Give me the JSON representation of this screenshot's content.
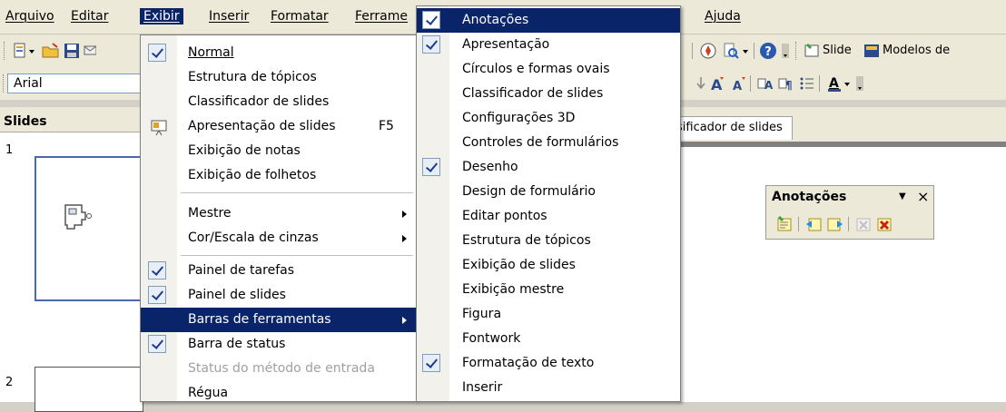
{
  "menubar": {
    "items": [
      {
        "label": "Arquivo",
        "active": false
      },
      {
        "label": "Editar",
        "active": false
      },
      {
        "label": "Exibir",
        "active": true
      },
      {
        "label": "Inserir",
        "active": false
      },
      {
        "label": "Formatar",
        "active": false
      },
      {
        "label": "Ferrame",
        "active": false
      },
      {
        "label": "Ajuda",
        "active": false
      }
    ]
  },
  "toolbar": {
    "slide_label": "Slide",
    "modelos_label": "Modelos de",
    "font_name": "Arial"
  },
  "slides_pane": {
    "title": "Slides",
    "slide_numbers": [
      "1",
      "2"
    ]
  },
  "view_tab": {
    "label": "sificador de slides"
  },
  "annotations_toolbar": {
    "title": "Anotações",
    "dropdown_glyph": "▼",
    "close_glyph": "×"
  },
  "exibir_menu": {
    "items": [
      {
        "label": "Normal",
        "checked": true
      },
      {
        "label": "Estrutura de tópicos"
      },
      {
        "label": "Classificador de slides"
      },
      {
        "label": "Apresentação de slides",
        "shortcut": "F5",
        "icon": "presentation-icon"
      },
      {
        "label": "Exibição de notas"
      },
      {
        "label": "Exibição de folhetos"
      },
      {
        "label": "Mestre",
        "submenu": true
      },
      {
        "label": "Cor/Escala de cinzas",
        "submenu": true
      },
      {
        "label": "Painel de tarefas",
        "checked": true
      },
      {
        "label": "Painel de slides",
        "checked": true
      },
      {
        "label": "Barras de ferramentas",
        "submenu": true,
        "highlighted": true
      },
      {
        "label": "Barra de status",
        "checked": true
      },
      {
        "label": "Status do método de entrada",
        "disabled": true
      },
      {
        "label": "Régua"
      }
    ]
  },
  "toolbars_submenu": {
    "items": [
      {
        "label": "Anotações",
        "checked": true,
        "highlighted": true
      },
      {
        "label": "Apresentação",
        "checked": true
      },
      {
        "label": "Círculos e formas ovais"
      },
      {
        "label": "Classificador de slides"
      },
      {
        "label": "Configurações 3D"
      },
      {
        "label": "Controles de formulários"
      },
      {
        "label": "Desenho",
        "checked": true
      },
      {
        "label": "Design de formulário"
      },
      {
        "label": "Editar pontos"
      },
      {
        "label": "Estrutura de tópicos"
      },
      {
        "label": "Exibição de slides"
      },
      {
        "label": "Exibição mestre"
      },
      {
        "label": "Figura"
      },
      {
        "label": "Fontwork"
      },
      {
        "label": "Formatação de texto",
        "checked": true
      },
      {
        "label": "Inserir"
      }
    ]
  },
  "colors": {
    "highlight": "#0a246a",
    "menu_bg": "#ffffff",
    "chrome": "#ece9d8"
  }
}
